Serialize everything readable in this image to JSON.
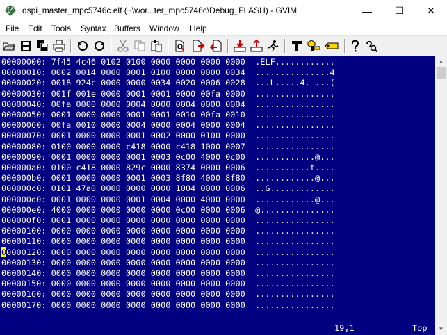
{
  "window": {
    "title": "dspi_master_mpc5746c.elf (~\\wor...ter_mpc5746c\\Debug_FLASH) - GVIM",
    "minimize": "—",
    "maximize": "☐",
    "close": "✕"
  },
  "menu": [
    "File",
    "Edit",
    "Tools",
    "Syntax",
    "Buffers",
    "Window",
    "Help"
  ],
  "toolbar": [
    "open-icon",
    "save-icon",
    "save-all-icon",
    "print-icon",
    "undo-icon",
    "redo-icon",
    "cut-icon",
    "copy-icon",
    "paste-icon",
    "find-replace-icon",
    "find-next-icon",
    "find-prev-icon",
    "load-session-icon",
    "save-session-icon",
    "run-script-icon",
    "make-icon",
    "tags-icon",
    "jump-tag-icon",
    "help-icon",
    "find-help-icon"
  ],
  "editor": {
    "lines": [
      "00000000: 7f45 4c46 0102 0100 0000 0000 0000 0000  .ELF............",
      "00000010: 0002 0014 0000 0001 0100 0000 0000 0034  ...............4",
      "00000020: 0018 924c 0000 0000 0034 0020 0006 0028  ...L.....4. ...(",
      "00000030: 001f 001e 0000 0001 0001 0000 00fa 0000  ................",
      "00000040: 00fa 0000 0000 0004 0000 0004 0000 0004  ................",
      "00000050: 0001 0000 0000 0001 0001 0010 00fa 0010  ................",
      "00000060: 00fa 0010 0000 0004 0000 0004 0000 0004  ................",
      "00000070: 0001 0000 0000 0001 0002 0000 0100 0000  ................",
      "00000080: 0100 0000 0000 c418 0000 c418 1000 0007  ................",
      "00000090: 0001 0000 0000 0001 0003 0c00 4000 0c00  ............@...",
      "000000a0: 0100 c418 0000 829c 0000 8374 0000 0006  ...........t....",
      "000000b0: 0001 0000 0000 0001 0003 8f80 4000 8f80  ............@...",
      "000000c0: 0101 47a0 0000 0000 0000 1004 0000 0006  ..G.............",
      "000000d0: 0001 0000 0000 0001 0004 0000 4000 0000  ............@...",
      "000000e0: 4000 0000 0000 0000 0000 0c00 0000 0006  @...............",
      "000000f0: 0001 0000 0000 0000 0000 0000 0000 0000  ................",
      "00000100: 0000 0000 0000 0000 0000 0000 0000 0000  ................",
      "00000110: 0000 0000 0000 0000 0000 0000 0000 0000  ................",
      "00000120: 0000 0000 0000 0000 0000 0000 0000 0000  ................",
      "00000130: 0000 0000 0000 0000 0000 0000 0000 0000  ................",
      "00000140: 0000 0000 0000 0000 0000 0000 0000 0000  ................",
      "00000150: 0000 0000 0000 0000 0000 0000 0000 0000  ................",
      "00000160: 0000 0000 0000 0000 0000 0000 0000 0000  ................",
      "00000170: 0000 0000 0000 0000 0000 0000 0000 0000  ................"
    ],
    "cursor_line": 18,
    "position": "19,1",
    "scroll": "Top"
  },
  "colors": {
    "editor_bg": "#000080",
    "editor_fg": "#ffffff",
    "cursor": "#ffff00"
  }
}
